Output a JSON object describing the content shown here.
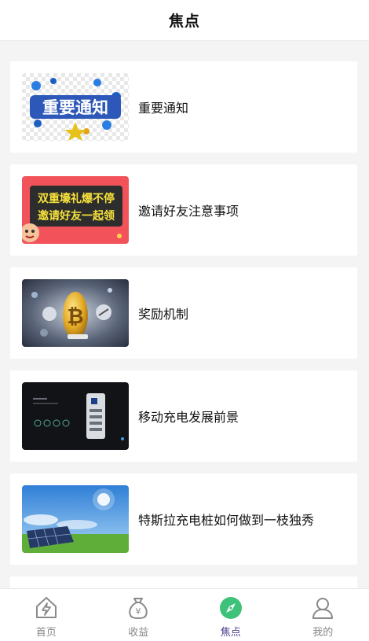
{
  "header": {
    "title": "焦点"
  },
  "articles": [
    {
      "title": "重要通知",
      "thumb_text": "重要通知"
    },
    {
      "title": "邀请好友注意事项",
      "thumb_line1": "双重壕礼爆不停",
      "thumb_line2": "邀请好友一起领"
    },
    {
      "title": "奖励机制"
    },
    {
      "title": "移动充电发展前景"
    },
    {
      "title": "特斯拉充电桩如何做到一枝独秀"
    }
  ],
  "tabbar": {
    "items": [
      {
        "label": "首页",
        "icon": "home-bolt-icon"
      },
      {
        "label": "收益",
        "icon": "money-bag-icon"
      },
      {
        "label": "焦点",
        "icon": "compass-icon",
        "active": true
      },
      {
        "label": "我的",
        "icon": "user-icon"
      }
    ],
    "active_color": "#4a3f8f",
    "active_icon_color": "#3ec27a"
  }
}
